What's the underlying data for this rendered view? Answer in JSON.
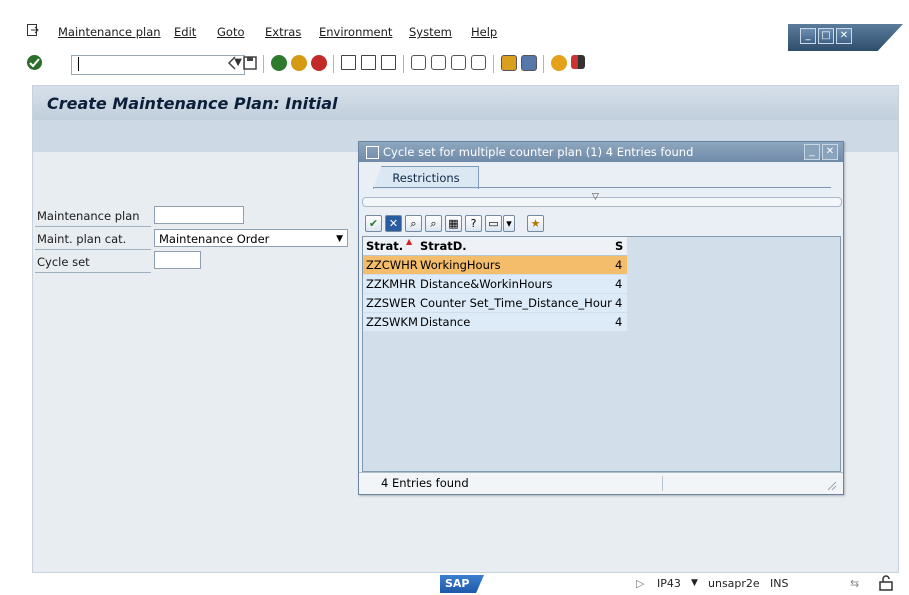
{
  "menu": {
    "items": [
      {
        "label": "Maintenance plan"
      },
      {
        "label": "Edit"
      },
      {
        "label": "Goto"
      },
      {
        "label": "Extras"
      },
      {
        "label": "Environment"
      },
      {
        "label": "System"
      },
      {
        "label": "Help"
      }
    ]
  },
  "toolbar": {
    "command_value": "",
    "icons": [
      "enter-icon",
      "back-icon",
      "save-icon",
      "back-green-icon",
      "exit-icon",
      "cancel-icon",
      "print-icon",
      "find-icon",
      "find-next-icon",
      "first-page-icon",
      "prev-page-icon",
      "next-page-icon",
      "last-page-icon",
      "create-session-icon",
      "shortcut-icon",
      "help-icon",
      "layout-icon"
    ]
  },
  "main": {
    "title": "Create Maintenance Plan: Initial",
    "fields": {
      "plan_label": "Maintenance plan",
      "plan_value": "",
      "cat_label": "Maint. plan cat.",
      "cat_value": "Maintenance Order",
      "cycle_label": "Cycle set",
      "cycle_value": ""
    }
  },
  "popup": {
    "title": "Cycle set for multiple counter plan (1)    4 Entries found",
    "tab": "Restrictions",
    "columns": {
      "c1": "Strat.",
      "c2": "StratD.",
      "c3": "S"
    },
    "rows": [
      {
        "strat": "ZZCWHR",
        "desc": "WorkingHours",
        "s": "4",
        "selected": true
      },
      {
        "strat": "ZZKMHR",
        "desc": "Distance&WorkinHours",
        "s": "4",
        "selected": false
      },
      {
        "strat": "ZZSWER",
        "desc": "Counter Set_Time_Distance_Hour",
        "s": "4",
        "selected": false
      },
      {
        "strat": "ZZSWKM",
        "desc": "Distance",
        "s": "4",
        "selected": false
      }
    ],
    "status": "4 Entries found"
  },
  "statusbar": {
    "logo": "SAP",
    "system": "IP43",
    "server": "unsapr2e",
    "mode": "INS"
  },
  "colors": {
    "selected_row": "#f4bd6b",
    "row_bg": "#dcebf7",
    "title_text": "#0c1f38"
  }
}
